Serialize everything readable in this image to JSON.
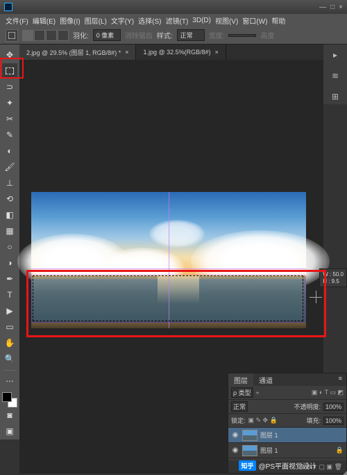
{
  "window": {
    "minimize": "—",
    "maximize": "□",
    "close": "×"
  },
  "menu": {
    "file": "文件(F)",
    "edit": "编辑(E)",
    "image": "图像(I)",
    "layer": "图层(L)",
    "type": "文字(Y)",
    "select": "选择(S)",
    "filter": "滤镜(T)",
    "threed": "3D(D)",
    "view": "视图(V)",
    "window": "窗口(W)",
    "help": "帮助"
  },
  "options": {
    "feather_label": "羽化:",
    "feather_value": "0 像素",
    "antialias": "消除锯齿",
    "style_label": "样式:",
    "style_value": "正常",
    "width_label": "宽度:",
    "height_label": "高度"
  },
  "tabs": [
    {
      "label": "2.jpg @ 29.5% (图层 1, RGB/8#) *",
      "close": "×"
    },
    {
      "label": "1.jpg @ 32.5%(RGB/8#)",
      "close": "×"
    }
  ],
  "tooltip": {
    "w_label": "W :",
    "w_value": "50.0",
    "h_label": "H :",
    "h_value": "9.5"
  },
  "layers": {
    "tab_layers": "图层",
    "tab_channels": "通道",
    "kind_label": "ρ 类型",
    "kind_drop": "÷",
    "blend": "正常",
    "opacity_label": "不透明度:",
    "opacity_value": "100%",
    "lock_label": "锁定:",
    "fill_label": "填充:",
    "fill_value": "100%",
    "layer1_name": "图层 1",
    "bg_name": "图层 1",
    "footer_icons": "⊕  fx  ◐  ▢  ▣  🗑"
  },
  "watermark": {
    "brand": "知乎",
    "text": "@PS平面视觉设计"
  }
}
